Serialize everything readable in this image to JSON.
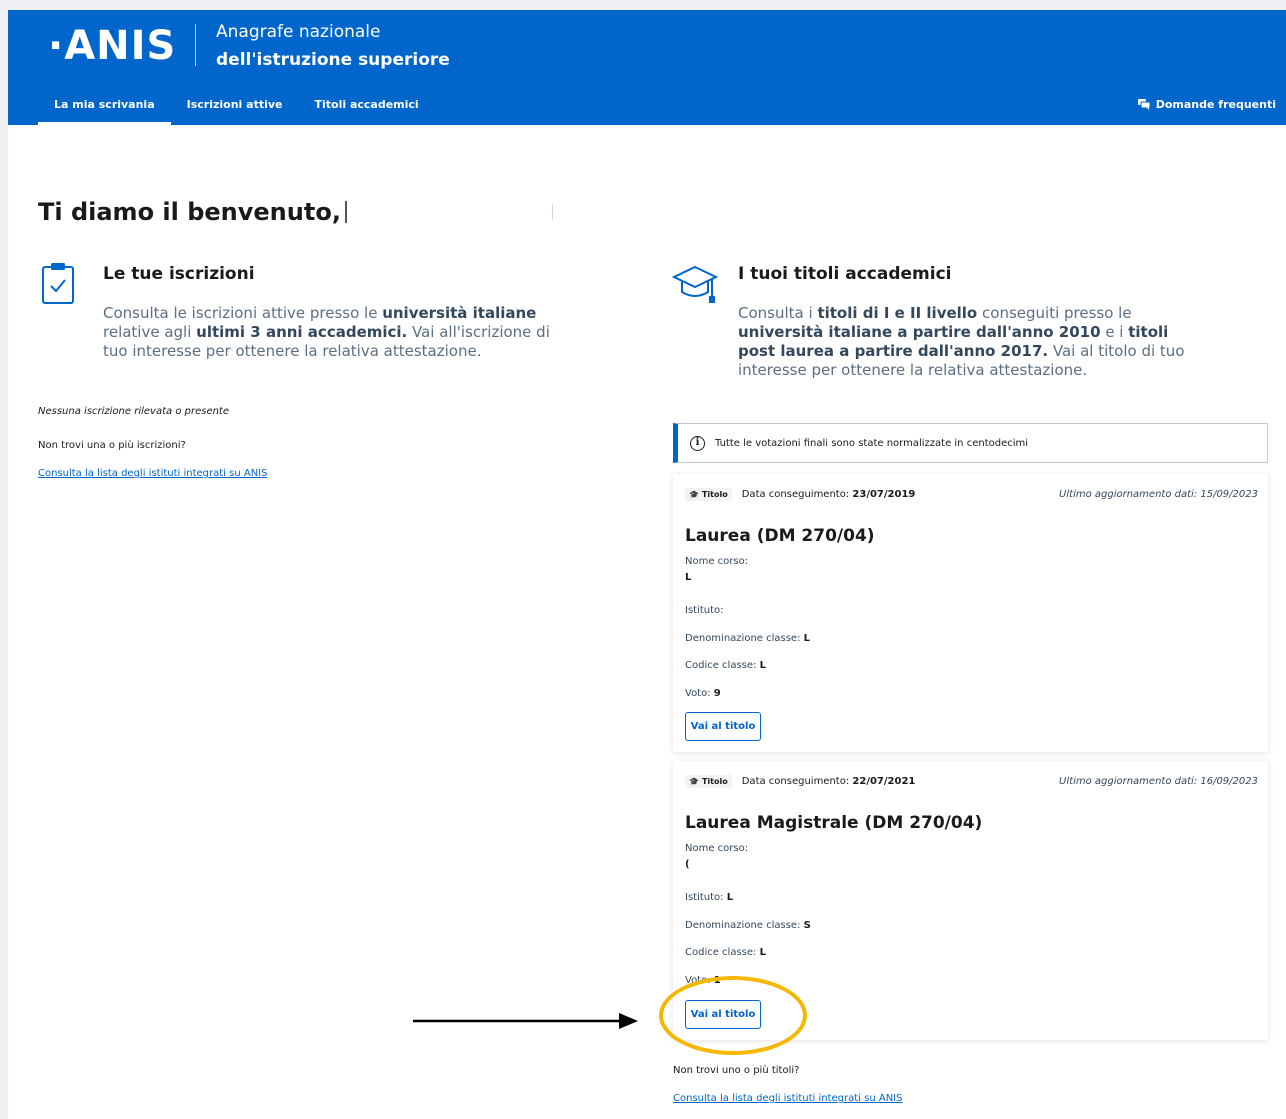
{
  "header": {
    "logo": "·ANIS",
    "brand_line1": "Anagrafe nazionale",
    "brand_line2": "dell'istruzione superiore",
    "nav": [
      {
        "label": "La mia scrivania",
        "active": true
      },
      {
        "label": "Iscrizioni attive",
        "active": false
      },
      {
        "label": "Titoli accademici",
        "active": false
      }
    ],
    "faq": "Domande frequenti",
    "bg_color": "#0066cc"
  },
  "welcome": "Ti diamo il benvenuto,",
  "iscrizioni": {
    "title": "Le tue iscrizioni",
    "desc_parts": [
      "Consulta le iscrizioni attive presso le ",
      "università italiane",
      " relative agli ",
      "ultimi 3 anni accademici.",
      " Vai all'iscrizione di tuo interesse per ottenere la relativa attestazione."
    ],
    "empty": "Nessuna iscrizione rilevata o presente",
    "missing_q": "Non trovi una o più iscrizioni?",
    "link": "Consulta la lista degli istituti integrati su ANIS"
  },
  "titoli": {
    "title": "I tuoi titoli accademici",
    "desc_parts": [
      "Consulta i ",
      "titoli di I e II livello",
      " conseguiti presso le ",
      "università italiane a partire dall'anno 2010",
      " e i ",
      "titoli post laurea a partire dall'anno 2017.",
      " Vai al titolo di tuo interesse per ottenere la relativa attestazione."
    ],
    "info": "Tutte le votazioni finali sono state normalizzate in centodecimi",
    "cards": [
      {
        "badge": "Titolo",
        "date_label": "Data conseguimento:",
        "date": "23/07/2019",
        "updated": "Ultimo aggiornamento dati: 15/09/2023",
        "title": "Laurea (DM 270/04)",
        "nome_corso_label": "Nome corso:",
        "nome_corso_value": "L",
        "istituto_label": "Istituto:",
        "istituto_value": "",
        "classe_label": "Denominazione classe:",
        "classe_value": "L",
        "codice_label": "Codice classe:",
        "codice_value": "L",
        "voto_label": "Voto:",
        "voto_value": "9",
        "button": "Vai al titolo"
      },
      {
        "badge": "Titolo",
        "date_label": "Data conseguimento:",
        "date": "22/07/2021",
        "updated": "Ultimo aggiornamento dati: 16/09/2023",
        "title": "Laurea Magistrale (DM 270/04)",
        "nome_corso_label": "Nome corso:",
        "nome_corso_value": "(",
        "istituto_label": "Istituto:",
        "istituto_value": "L",
        "classe_label": "Denominazione classe:",
        "classe_value": "S",
        "codice_label": "Codice classe:",
        "codice_value": "L",
        "voto_label": "Voto:",
        "voto_value": "1",
        "button": "Vai al titolo"
      }
    ],
    "missing_q": "Non trovi uno o più titoli?",
    "link": "Consulta la lista degli istituti integrati su ANIS"
  },
  "colors": {
    "accent": "#0066cc",
    "highlight": "#f6b700",
    "muted_text": "#5c6f82"
  }
}
